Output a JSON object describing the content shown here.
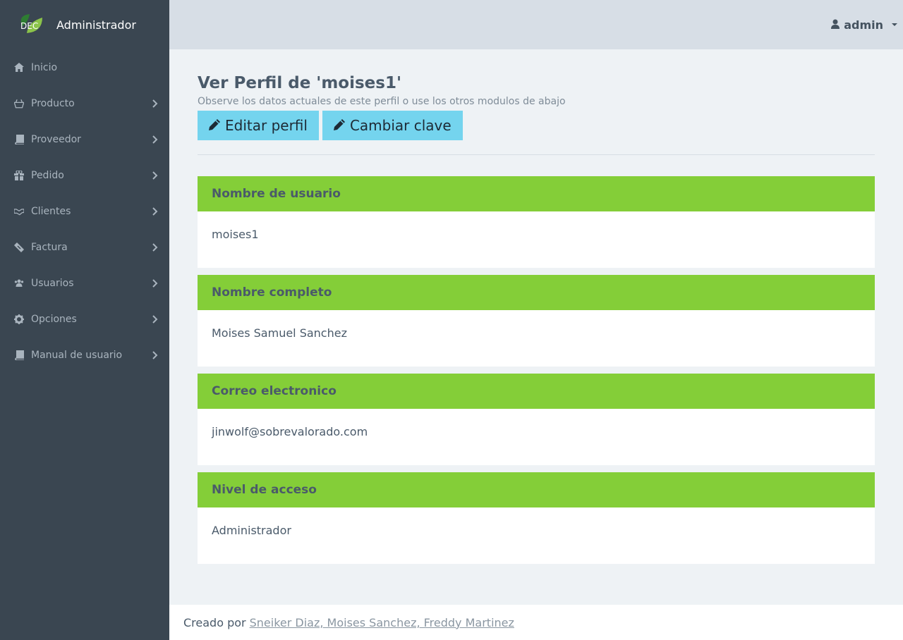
{
  "sidebar": {
    "brand": {
      "title": "Administrador",
      "logo_text": "DEC",
      "logo_colors": [
        "#2e7d32",
        "#8bc34a"
      ]
    },
    "items": [
      {
        "label": "Inicio",
        "icon": "home-icon",
        "has_children": false
      },
      {
        "label": "Producto",
        "icon": "basket-icon",
        "has_children": true
      },
      {
        "label": "Proveedor",
        "icon": "book-icon",
        "has_children": true
      },
      {
        "label": "Pedido",
        "icon": "gift-icon",
        "has_children": true
      },
      {
        "label": "Clientes",
        "icon": "handshake-icon",
        "has_children": true
      },
      {
        "label": "Factura",
        "icon": "ticket-icon",
        "has_children": true
      },
      {
        "label": "Usuarios",
        "icon": "users-icon",
        "has_children": true
      },
      {
        "label": "Opciones",
        "icon": "gear-icon",
        "has_children": true
      },
      {
        "label": "Manual de usuario",
        "icon": "book-icon",
        "has_children": true
      }
    ]
  },
  "header": {
    "user": "admin",
    "user_icon": "user-icon"
  },
  "main": {
    "title": "Ver Perfil de 'moises1'",
    "subtitle": "Observe los datos actuales de este perfil o use los otros modulos de abajo",
    "buttons": {
      "edit": "Editar perfil",
      "change_password": "Cambiar clave"
    },
    "fields": [
      {
        "label": "Nombre de usuario",
        "value": "moises1"
      },
      {
        "label": "Nombre completo",
        "value": "Moises Samuel Sanchez"
      },
      {
        "label": "Correo electronico",
        "value": "jinwolf@sobrevalorado.com"
      },
      {
        "label": "Nivel de acceso",
        "value": "Administrador"
      }
    ]
  },
  "footer": {
    "prefix": "Creado por",
    "authors": "Sneiker Diaz, Moises Sanchez, Freddy Martinez"
  },
  "colors": {
    "sidebar": "#3a4651",
    "topbar": "#d7dee6",
    "card_header": "#84ce38",
    "button": "#74d4ee"
  }
}
